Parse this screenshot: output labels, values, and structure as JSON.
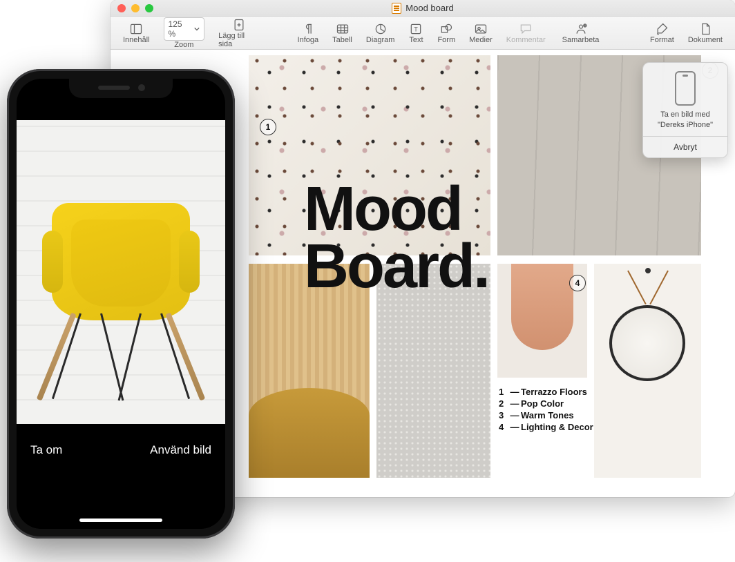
{
  "window": {
    "title": "Mood board"
  },
  "toolbar": {
    "content_label": "Innehåll",
    "zoom_value": "125 %",
    "zoom_label": "Zoom",
    "add_page_label": "Lägg till sida",
    "insert_label": "Infoga",
    "table_label": "Tabell",
    "chart_label": "Diagram",
    "text_label": "Text",
    "shape_label": "Form",
    "media_label": "Medier",
    "comment_label": "Kommentar",
    "collaborate_label": "Samarbeta",
    "format_label": "Format",
    "document_label": "Dokument"
  },
  "document": {
    "title_line1": "Mood",
    "title_line2": "Board.",
    "callouts": {
      "c1": "1",
      "c2": "2",
      "c4": "4"
    },
    "legend": [
      {
        "num": "1",
        "dash": "—",
        "text": "Terrazzo Floors"
      },
      {
        "num": "2",
        "dash": "—",
        "text": "Pop Color"
      },
      {
        "num": "3",
        "dash": "—",
        "text": "Warm Tones"
      },
      {
        "num": "4",
        "dash": "—",
        "text": "Lighting & Decor"
      }
    ]
  },
  "popover": {
    "text": "Ta en bild med \"Dereks iPhone\"",
    "cancel": "Avbryt"
  },
  "iphone": {
    "retake": "Ta om",
    "use_photo": "Använd bild"
  }
}
